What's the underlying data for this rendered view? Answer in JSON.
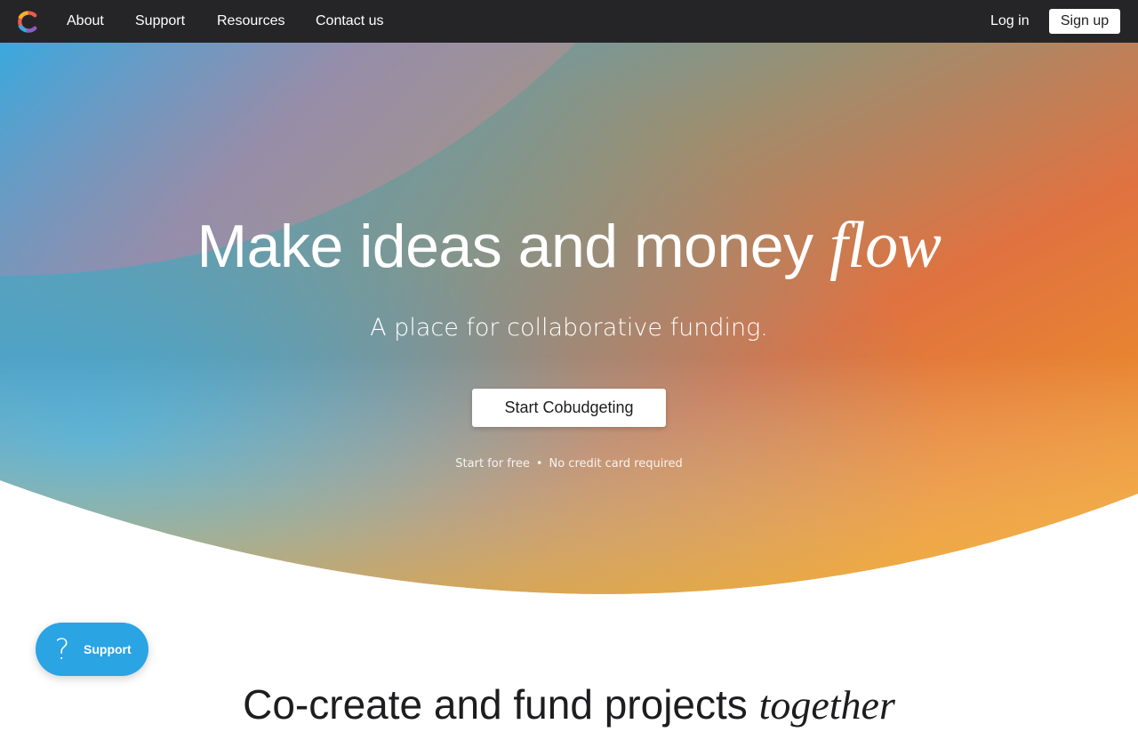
{
  "nav": {
    "links": [
      "About",
      "Support",
      "Resources",
      "Contact us"
    ],
    "login": "Log in",
    "signup": "Sign up"
  },
  "hero": {
    "title_main": "Make ideas and money ",
    "title_accent": "flow",
    "subtitle": "A place for collaborative funding.",
    "cta_label": "Start Cobudgeting",
    "fine_left": "Start for free",
    "fine_sep": "•",
    "fine_right": "No credit card required"
  },
  "section2": {
    "title_main": "Co-create and fund projects ",
    "title_accent": "together"
  },
  "support_widget": {
    "label": "Support",
    "icon": "question-icon"
  },
  "colors": {
    "navbar": "#252527",
    "hero_blue": "#3aa9de",
    "hero_orange": "#ee6a34",
    "hero_yellow": "#f0b232",
    "support_blue": "#2aa4e3"
  }
}
